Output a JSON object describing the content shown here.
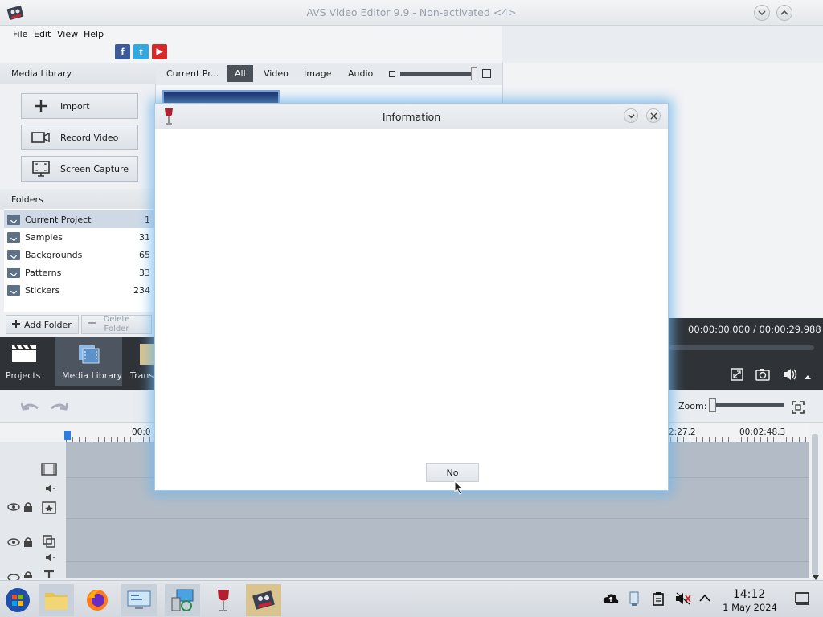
{
  "window": {
    "title": "AVS Video Editor 9.9 - Non-activated <4>"
  },
  "menu": [
    "File",
    "Edit",
    "View",
    "Help"
  ],
  "social": {
    "facebook": "f",
    "twitter": "t",
    "youtube": "▶"
  },
  "media_library": {
    "header": "Media Library",
    "buttons": {
      "import": "Import",
      "record": "Record Video",
      "capture": "Screen Capture"
    }
  },
  "folders": {
    "header": "Folders",
    "items": [
      {
        "name": "Current Project",
        "count": "1"
      },
      {
        "name": "Samples",
        "count": "31"
      },
      {
        "name": "Backgrounds",
        "count": "65"
      },
      {
        "name": "Patterns",
        "count": "33"
      },
      {
        "name": "Stickers",
        "count": "234"
      }
    ],
    "add_label": "Add Folder",
    "delete_label": "Delete Folder"
  },
  "nav": {
    "projects": "Projects",
    "media_library": "Media Library",
    "transitions": "Trans"
  },
  "media_tabs": {
    "current": "Current Pr...",
    "all": "All",
    "video": "Video",
    "image": "Image",
    "audio": "Audio"
  },
  "preview": {
    "timecode": "00:00:00.000 /  00:00:29.988"
  },
  "timeline": {
    "zoom_label": "Zoom:",
    "tick_left": "00:0",
    "tick_a": "2:27.2",
    "tick_b": "00:02:48.3"
  },
  "dialog": {
    "title": "Information",
    "no_button": "No"
  },
  "taskbar": {
    "time": "14:12",
    "date": "1 May 2024"
  },
  "colors": {
    "accent": "#2f3338",
    "dialog_glow": "#6eb4eb"
  }
}
